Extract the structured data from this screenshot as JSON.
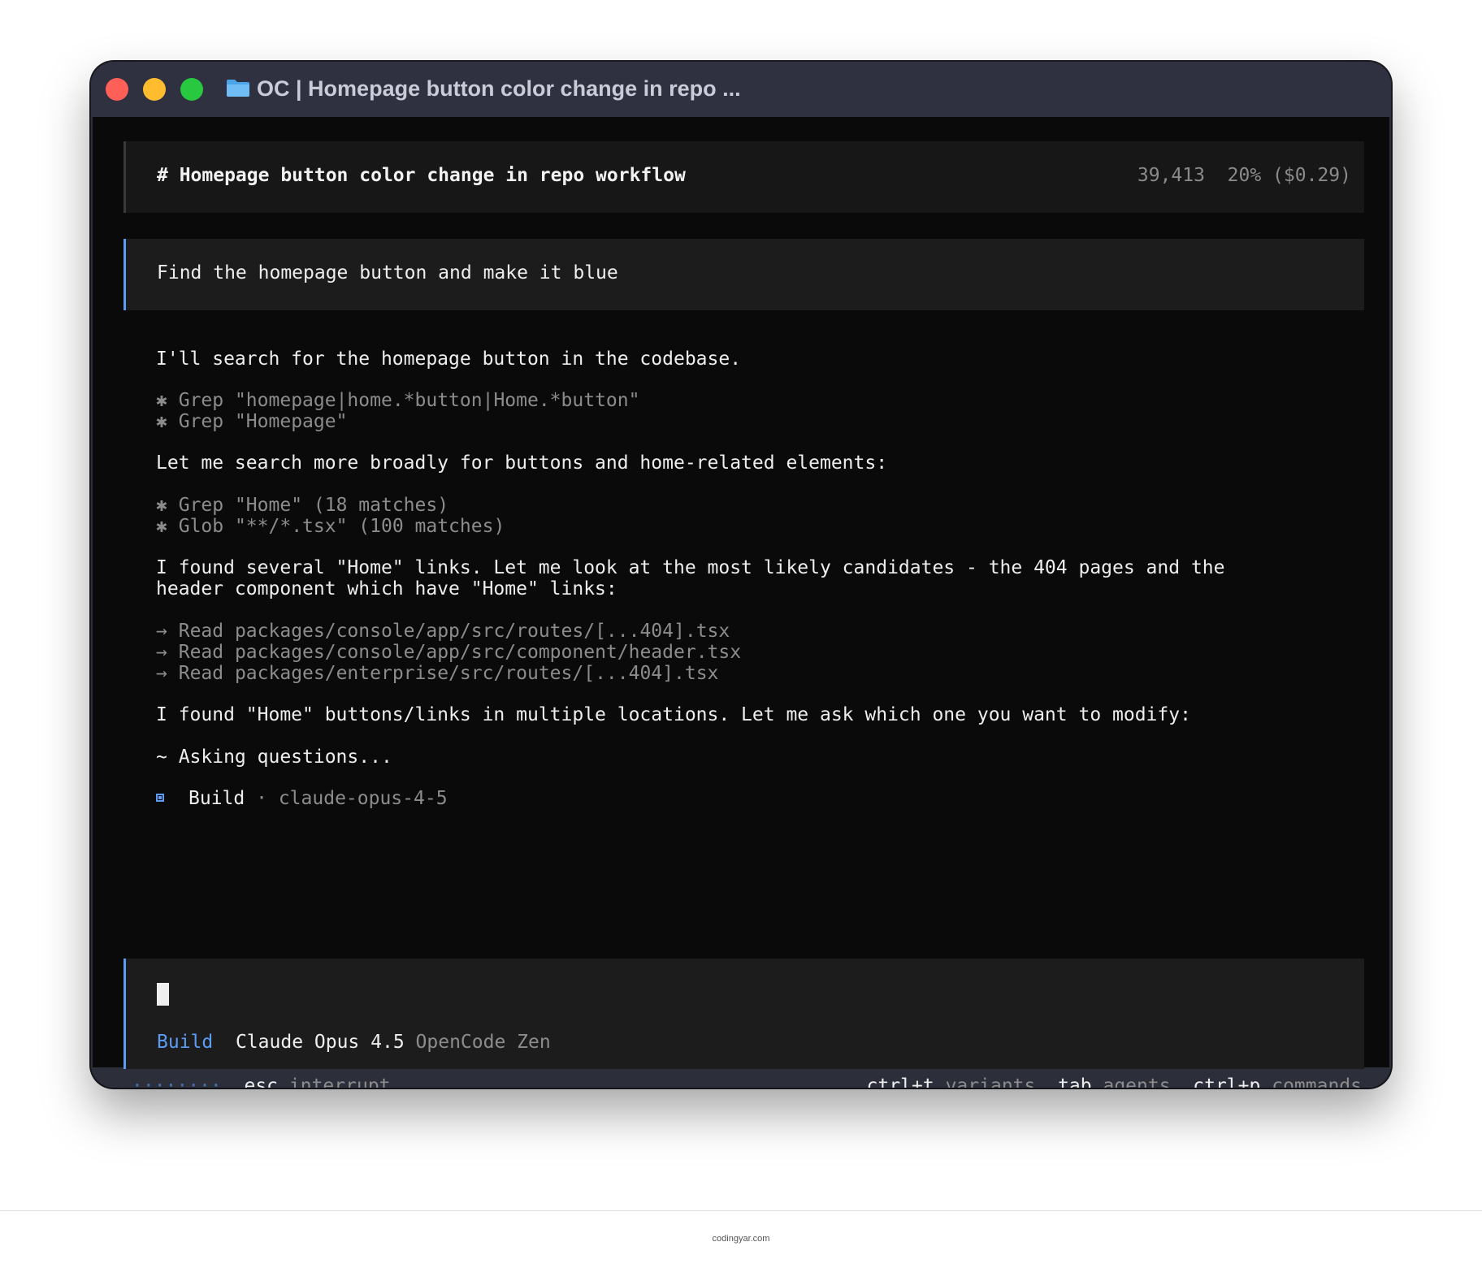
{
  "window": {
    "title": "OC | Homepage button color change in repo ..."
  },
  "session": {
    "heading": "# Homepage button color change in repo workflow",
    "tokens": "39,413",
    "usage": "20% ($0.29)"
  },
  "prompt": "Find the homepage button and make it blue",
  "transcript": {
    "intro": "I'll search for the homepage button in the codebase.",
    "tool1_bullet": "✱",
    "tool1": "Grep \"homepage|home.*button|Home.*button\"",
    "tool2_bullet": "✱",
    "tool2": "Grep \"Homepage\"",
    "msg2": "Let me search more broadly for buttons and home-related elements:",
    "tool3_bullet": "✱",
    "tool3": "Grep \"Home\" (18 matches)",
    "tool4_bullet": "✱",
    "tool4": "Glob \"**/*.tsx\" (100 matches)",
    "msg3_line1": "I found several \"Home\" links. Let me look at the most likely candidates - the 404 pages and the",
    "msg3_line2": "header component which have \"Home\" links:",
    "read_arrow": "→",
    "read1": "Read packages/console/app/src/routes/[...404].tsx",
    "read2": "Read packages/console/app/src/component/header.tsx",
    "read3": "Read packages/enterprise/src/routes/[...404].tsx",
    "msg4": "I found \"Home\" buttons/links in multiple locations. Let me ask which one you want to modify:",
    "asking": "~ Asking questions...",
    "agent_label": "Build",
    "agent_sep": "·",
    "agent_model": "claude-opus-4-5"
  },
  "input": {
    "mode": "Build",
    "model": "Claude Opus 4.5",
    "provider": "OpenCode Zen"
  },
  "footer": {
    "spinner": "········",
    "esc_key": "esc",
    "esc_label": "interrupt",
    "variants_key": "ctrl+t",
    "variants_label": "variants",
    "agents_key": "tab",
    "agents_label": "agents",
    "commands_key": "ctrl+p",
    "commands_label": "commands"
  },
  "watermark": "codingyar.com",
  "colors": {
    "accent": "#5c9cf5",
    "terminal_bg": "#0a0a0a",
    "panel_bg": "#1c1c1c",
    "titlebar_bg": "#2f3140",
    "close": "#fe5f57",
    "minimize": "#febc2e",
    "maximize": "#28c840"
  },
  "icons": {
    "folder": "folder-icon",
    "agent": "square-icon"
  }
}
